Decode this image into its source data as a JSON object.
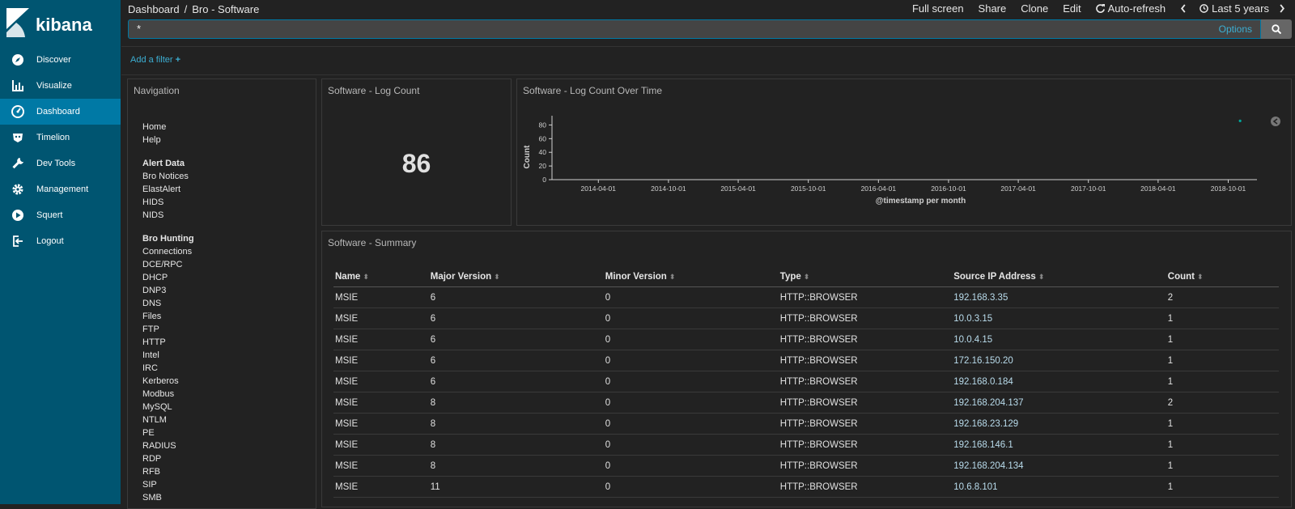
{
  "app": {
    "name": "kibana"
  },
  "sidebar": {
    "items": [
      {
        "label": "Discover",
        "icon": "compass-icon"
      },
      {
        "label": "Visualize",
        "icon": "bar-chart-icon"
      },
      {
        "label": "Dashboard",
        "icon": "dashboard-icon",
        "active": true
      },
      {
        "label": "Timelion",
        "icon": "timelion-icon"
      },
      {
        "label": "Dev Tools",
        "icon": "wrench-icon"
      },
      {
        "label": "Management",
        "icon": "gear-icon"
      },
      {
        "label": "Squert",
        "icon": "play-circle-icon"
      },
      {
        "label": "Logout",
        "icon": "logout-icon"
      }
    ]
  },
  "breadcrumb": {
    "root": "Dashboard",
    "separator": "/",
    "current": "Bro - Software"
  },
  "top_actions": {
    "full_screen": "Full screen",
    "share": "Share",
    "clone": "Clone",
    "edit": "Edit",
    "auto_refresh": "Auto-refresh",
    "time_range": "Last 5 years"
  },
  "search": {
    "value": "*",
    "options_label": "Options"
  },
  "filter": {
    "add_label": "Add a filter"
  },
  "panels": {
    "navigation": {
      "title": "Navigation",
      "groups": [
        {
          "header": "",
          "links": [
            "Home",
            "Help"
          ]
        },
        {
          "header": "Alert Data",
          "links": [
            "Bro Notices",
            "ElastAlert",
            "HIDS",
            "NIDS"
          ]
        },
        {
          "header": "Bro Hunting",
          "links": [
            "Connections",
            "DCE/RPC",
            "DHCP",
            "DNP3",
            "DNS",
            "Files",
            "FTP",
            "HTTP",
            "Intel",
            "IRC",
            "Kerberos",
            "Modbus",
            "MySQL",
            "NTLM",
            "PE",
            "RADIUS",
            "RDP",
            "RFB",
            "SIP",
            "SMB"
          ]
        }
      ]
    },
    "log_count": {
      "title": "Software - Log Count",
      "value": "86"
    },
    "log_count_over_time": {
      "title": "Software - Log Count Over Time"
    },
    "summary": {
      "title": "Software - Summary",
      "columns": [
        "Name",
        "Major Version",
        "Minor Version",
        "Type",
        "Source IP Address",
        "Count"
      ],
      "rows": [
        [
          "MSIE",
          "6",
          "0",
          "HTTP::BROWSER",
          "192.168.3.35",
          "2"
        ],
        [
          "MSIE",
          "6",
          "0",
          "HTTP::BROWSER",
          "10.0.3.15",
          "1"
        ],
        [
          "MSIE",
          "6",
          "0",
          "HTTP::BROWSER",
          "10.0.4.15",
          "1"
        ],
        [
          "MSIE",
          "6",
          "0",
          "HTTP::BROWSER",
          "172.16.150.20",
          "1"
        ],
        [
          "MSIE",
          "6",
          "0",
          "HTTP::BROWSER",
          "192.168.0.184",
          "1"
        ],
        [
          "MSIE",
          "8",
          "0",
          "HTTP::BROWSER",
          "192.168.204.137",
          "2"
        ],
        [
          "MSIE",
          "8",
          "0",
          "HTTP::BROWSER",
          "192.168.23.129",
          "1"
        ],
        [
          "MSIE",
          "8",
          "0",
          "HTTP::BROWSER",
          "192.168.146.1",
          "1"
        ],
        [
          "MSIE",
          "8",
          "0",
          "HTTP::BROWSER",
          "192.168.204.134",
          "1"
        ],
        [
          "MSIE",
          "11",
          "0",
          "HTTP::BROWSER",
          "10.6.8.101",
          "1"
        ]
      ]
    }
  },
  "chart_data": {
    "type": "line",
    "title": "Software - Log Count Over Time",
    "xlabel": "@timestamp per month",
    "ylabel": "Count",
    "ylim": [
      0,
      90
    ],
    "yticks": [
      0,
      20,
      40,
      60,
      80
    ],
    "xticks": [
      "2014-04-01",
      "2014-10-01",
      "2015-04-01",
      "2015-10-01",
      "2016-04-01",
      "2016-10-01",
      "2017-04-01",
      "2017-10-01",
      "2018-04-01",
      "2018-10-01"
    ],
    "xrange": [
      "2013-12-01",
      "2018-12-15"
    ],
    "points": [
      {
        "x": "2018-11-01",
        "y": 86
      }
    ]
  },
  "colors": {
    "sidebar": "#005571",
    "sidebar_active": "#0079a5",
    "background": "#222222",
    "accent": "#3caed2"
  }
}
